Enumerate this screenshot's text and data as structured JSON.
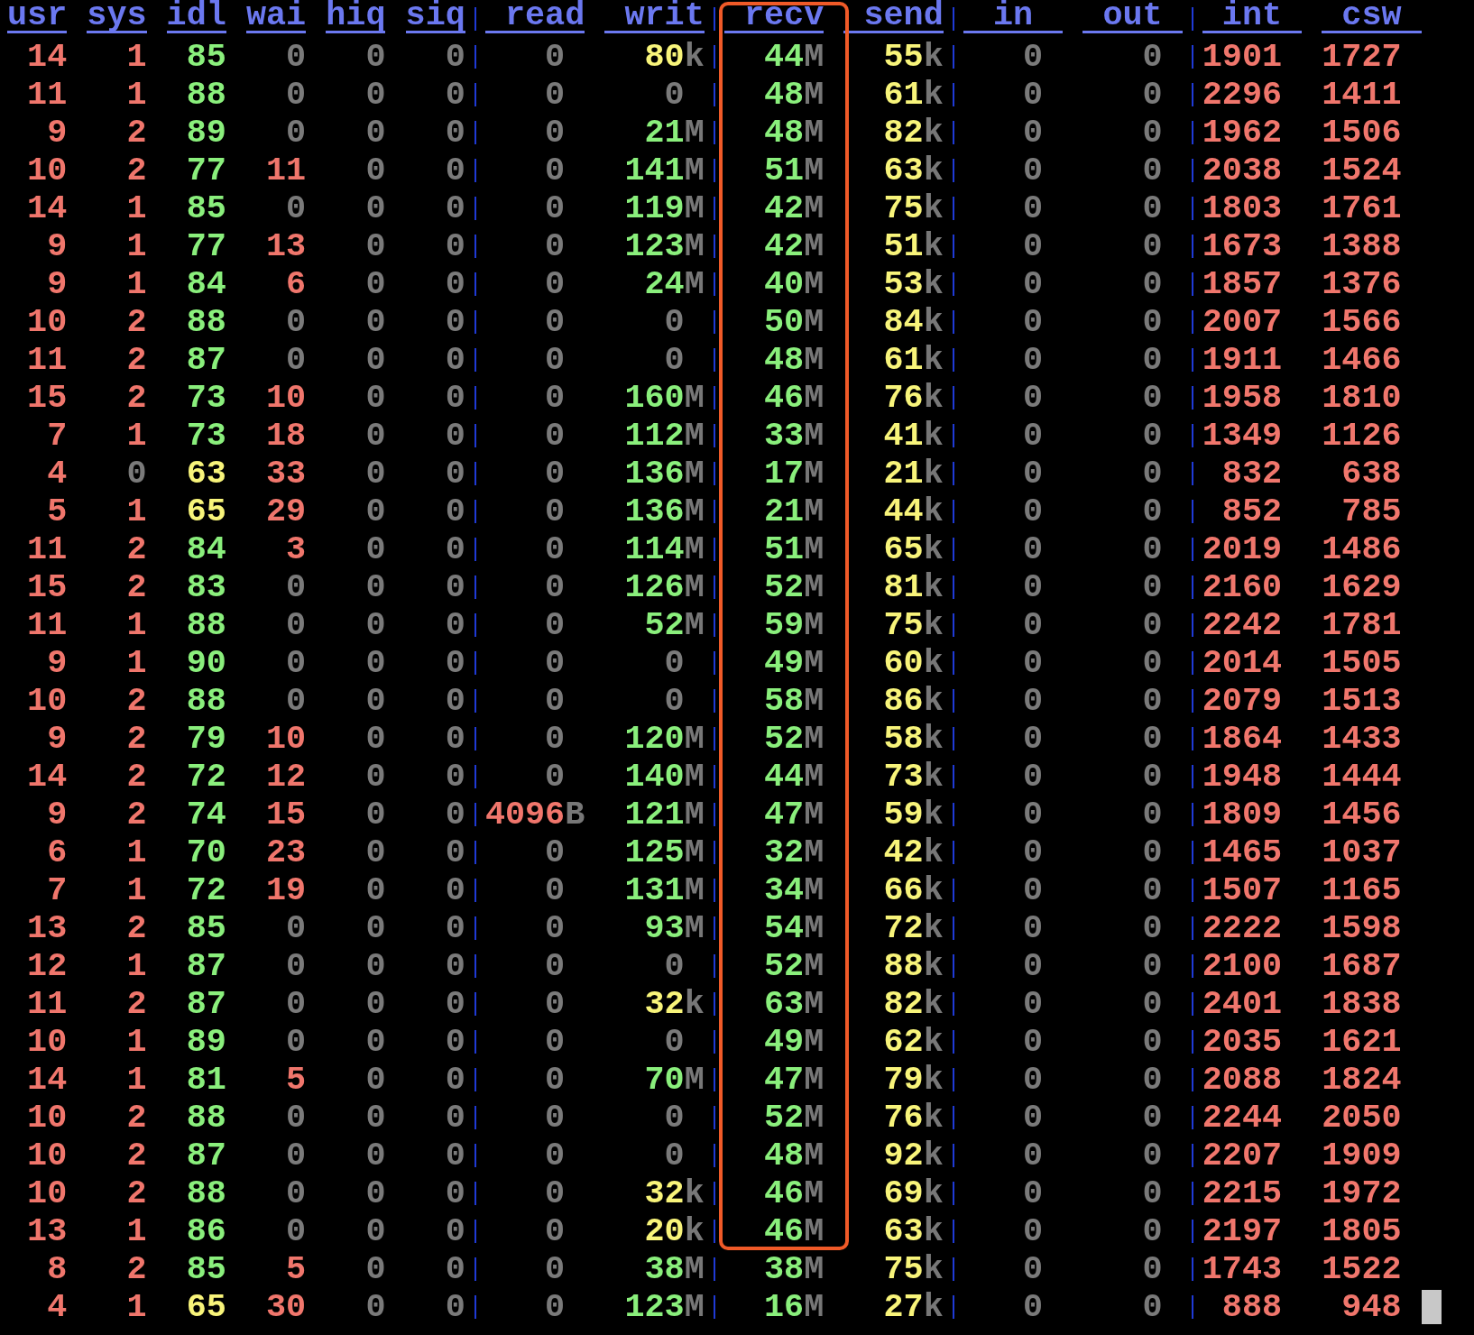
{
  "columns": [
    {
      "label": "usr",
      "kind": "cpu"
    },
    {
      "label": "sys",
      "kind": "cpu"
    },
    {
      "label": "idl",
      "kind": "cpu"
    },
    {
      "label": "wai",
      "kind": "cpu"
    },
    {
      "label": "hiq",
      "kind": "cpu"
    },
    {
      "label": "siq",
      "kind": "cpu"
    },
    {
      "label": "read",
      "kind": "throughput"
    },
    {
      "label": "writ",
      "kind": "throughput"
    },
    {
      "label": "recv",
      "kind": "throughput"
    },
    {
      "label": "send",
      "kind": "throughput"
    },
    {
      "label": "in",
      "kind": "counter"
    },
    {
      "label": "out",
      "kind": "counter"
    },
    {
      "label": "int",
      "kind": "counter"
    },
    {
      "label": "csw",
      "kind": "counter"
    }
  ],
  "rows": [
    {
      "cells": [
        {
          "value": "14",
          "color": "#f0766c"
        },
        {
          "value": "1",
          "color": "#f0766c"
        },
        {
          "value": "85",
          "color": "#8aef7c"
        },
        {
          "value": "0",
          "color": "#7a7a7a"
        },
        {
          "value": "0",
          "color": "#7a7a7a"
        },
        {
          "value": "0",
          "color": "#7a7a7a"
        },
        {
          "value": "0",
          "color": "#7a7a7a"
        },
        {
          "value": "80",
          "unit": "k",
          "color": "#f8f47a"
        },
        {
          "value": "44",
          "unit": "M",
          "color": "#8aef7c"
        },
        {
          "value": "55",
          "unit": "k",
          "color": "#f8f47a"
        },
        {
          "value": "0",
          "color": "#7a7a7a"
        },
        {
          "value": "0",
          "color": "#7a7a7a"
        },
        {
          "value": "1901",
          "color": "#f0766c"
        },
        {
          "value": "1727",
          "color": "#f0766c"
        }
      ]
    },
    {
      "cells": [
        {
          "value": "11",
          "color": "#f0766c"
        },
        {
          "value": "1",
          "color": "#f0766c"
        },
        {
          "value": "88",
          "color": "#8aef7c"
        },
        {
          "value": "0",
          "color": "#7a7a7a"
        },
        {
          "value": "0",
          "color": "#7a7a7a"
        },
        {
          "value": "0",
          "color": "#7a7a7a"
        },
        {
          "value": "0",
          "color": "#7a7a7a"
        },
        {
          "value": "0",
          "color": "#7a7a7a"
        },
        {
          "value": "48",
          "unit": "M",
          "color": "#8aef7c"
        },
        {
          "value": "61",
          "unit": "k",
          "color": "#f8f47a"
        },
        {
          "value": "0",
          "color": "#7a7a7a"
        },
        {
          "value": "0",
          "color": "#7a7a7a"
        },
        {
          "value": "2296",
          "color": "#f0766c"
        },
        {
          "value": "1411",
          "color": "#f0766c"
        }
      ]
    },
    {
      "cells": [
        {
          "value": "9",
          "color": "#f0766c"
        },
        {
          "value": "2",
          "color": "#f0766c"
        },
        {
          "value": "89",
          "color": "#8aef7c"
        },
        {
          "value": "0",
          "color": "#7a7a7a"
        },
        {
          "value": "0",
          "color": "#7a7a7a"
        },
        {
          "value": "0",
          "color": "#7a7a7a"
        },
        {
          "value": "0",
          "color": "#7a7a7a"
        },
        {
          "value": "21",
          "unit": "M",
          "color": "#8aef7c"
        },
        {
          "value": "48",
          "unit": "M",
          "color": "#8aef7c"
        },
        {
          "value": "82",
          "unit": "k",
          "color": "#f8f47a"
        },
        {
          "value": "0",
          "color": "#7a7a7a"
        },
        {
          "value": "0",
          "color": "#7a7a7a"
        },
        {
          "value": "1962",
          "color": "#f0766c"
        },
        {
          "value": "1506",
          "color": "#f0766c"
        }
      ]
    },
    {
      "cells": [
        {
          "value": "10",
          "color": "#f0766c"
        },
        {
          "value": "2",
          "color": "#f0766c"
        },
        {
          "value": "77",
          "color": "#8aef7c"
        },
        {
          "value": "11",
          "color": "#f0766c"
        },
        {
          "value": "0",
          "color": "#7a7a7a"
        },
        {
          "value": "0",
          "color": "#7a7a7a"
        },
        {
          "value": "0",
          "color": "#7a7a7a"
        },
        {
          "value": "141",
          "unit": "M",
          "color": "#8aef7c"
        },
        {
          "value": "51",
          "unit": "M",
          "color": "#8aef7c"
        },
        {
          "value": "63",
          "unit": "k",
          "color": "#f8f47a"
        },
        {
          "value": "0",
          "color": "#7a7a7a"
        },
        {
          "value": "0",
          "color": "#7a7a7a"
        },
        {
          "value": "2038",
          "color": "#f0766c"
        },
        {
          "value": "1524",
          "color": "#f0766c"
        }
      ]
    },
    {
      "cells": [
        {
          "value": "14",
          "color": "#f0766c"
        },
        {
          "value": "1",
          "color": "#f0766c"
        },
        {
          "value": "85",
          "color": "#8aef7c"
        },
        {
          "value": "0",
          "color": "#7a7a7a"
        },
        {
          "value": "0",
          "color": "#7a7a7a"
        },
        {
          "value": "0",
          "color": "#7a7a7a"
        },
        {
          "value": "0",
          "color": "#7a7a7a"
        },
        {
          "value": "119",
          "unit": "M",
          "color": "#8aef7c"
        },
        {
          "value": "42",
          "unit": "M",
          "color": "#8aef7c"
        },
        {
          "value": "75",
          "unit": "k",
          "color": "#f8f47a"
        },
        {
          "value": "0",
          "color": "#7a7a7a"
        },
        {
          "value": "0",
          "color": "#7a7a7a"
        },
        {
          "value": "1803",
          "color": "#f0766c"
        },
        {
          "value": "1761",
          "color": "#f0766c"
        }
      ]
    },
    {
      "cells": [
        {
          "value": "9",
          "color": "#f0766c"
        },
        {
          "value": "1",
          "color": "#f0766c"
        },
        {
          "value": "77",
          "color": "#8aef7c"
        },
        {
          "value": "13",
          "color": "#f0766c"
        },
        {
          "value": "0",
          "color": "#7a7a7a"
        },
        {
          "value": "0",
          "color": "#7a7a7a"
        },
        {
          "value": "0",
          "color": "#7a7a7a"
        },
        {
          "value": "123",
          "unit": "M",
          "color": "#8aef7c"
        },
        {
          "value": "42",
          "unit": "M",
          "color": "#8aef7c"
        },
        {
          "value": "51",
          "unit": "k",
          "color": "#f8f47a"
        },
        {
          "value": "0",
          "color": "#7a7a7a"
        },
        {
          "value": "0",
          "color": "#7a7a7a"
        },
        {
          "value": "1673",
          "color": "#f0766c"
        },
        {
          "value": "1388",
          "color": "#f0766c"
        }
      ]
    },
    {
      "cells": [
        {
          "value": "9",
          "color": "#f0766c"
        },
        {
          "value": "1",
          "color": "#f0766c"
        },
        {
          "value": "84",
          "color": "#8aef7c"
        },
        {
          "value": "6",
          "color": "#f0766c"
        },
        {
          "value": "0",
          "color": "#7a7a7a"
        },
        {
          "value": "0",
          "color": "#7a7a7a"
        },
        {
          "value": "0",
          "color": "#7a7a7a"
        },
        {
          "value": "24",
          "unit": "M",
          "color": "#8aef7c"
        },
        {
          "value": "40",
          "unit": "M",
          "color": "#8aef7c"
        },
        {
          "value": "53",
          "unit": "k",
          "color": "#f8f47a"
        },
        {
          "value": "0",
          "color": "#7a7a7a"
        },
        {
          "value": "0",
          "color": "#7a7a7a"
        },
        {
          "value": "1857",
          "color": "#f0766c"
        },
        {
          "value": "1376",
          "color": "#f0766c"
        }
      ]
    },
    {
      "cells": [
        {
          "value": "10",
          "color": "#f0766c"
        },
        {
          "value": "2",
          "color": "#f0766c"
        },
        {
          "value": "88",
          "color": "#8aef7c"
        },
        {
          "value": "0",
          "color": "#7a7a7a"
        },
        {
          "value": "0",
          "color": "#7a7a7a"
        },
        {
          "value": "0",
          "color": "#7a7a7a"
        },
        {
          "value": "0",
          "color": "#7a7a7a"
        },
        {
          "value": "0",
          "color": "#7a7a7a"
        },
        {
          "value": "50",
          "unit": "M",
          "color": "#8aef7c"
        },
        {
          "value": "84",
          "unit": "k",
          "color": "#f8f47a"
        },
        {
          "value": "0",
          "color": "#7a7a7a"
        },
        {
          "value": "0",
          "color": "#7a7a7a"
        },
        {
          "value": "2007",
          "color": "#f0766c"
        },
        {
          "value": "1566",
          "color": "#f0766c"
        }
      ]
    },
    {
      "cells": [
        {
          "value": "11",
          "color": "#f0766c"
        },
        {
          "value": "2",
          "color": "#f0766c"
        },
        {
          "value": "87",
          "color": "#8aef7c"
        },
        {
          "value": "0",
          "color": "#7a7a7a"
        },
        {
          "value": "0",
          "color": "#7a7a7a"
        },
        {
          "value": "0",
          "color": "#7a7a7a"
        },
        {
          "value": "0",
          "color": "#7a7a7a"
        },
        {
          "value": "0",
          "color": "#7a7a7a"
        },
        {
          "value": "48",
          "unit": "M",
          "color": "#8aef7c"
        },
        {
          "value": "61",
          "unit": "k",
          "color": "#f8f47a"
        },
        {
          "value": "0",
          "color": "#7a7a7a"
        },
        {
          "value": "0",
          "color": "#7a7a7a"
        },
        {
          "value": "1911",
          "color": "#f0766c"
        },
        {
          "value": "1466",
          "color": "#f0766c"
        }
      ]
    },
    {
      "cells": [
        {
          "value": "15",
          "color": "#f0766c"
        },
        {
          "value": "2",
          "color": "#f0766c"
        },
        {
          "value": "73",
          "color": "#8aef7c"
        },
        {
          "value": "10",
          "color": "#f0766c"
        },
        {
          "value": "0",
          "color": "#7a7a7a"
        },
        {
          "value": "0",
          "color": "#7a7a7a"
        },
        {
          "value": "0",
          "color": "#7a7a7a"
        },
        {
          "value": "160",
          "unit": "M",
          "color": "#8aef7c"
        },
        {
          "value": "46",
          "unit": "M",
          "color": "#8aef7c"
        },
        {
          "value": "76",
          "unit": "k",
          "color": "#f8f47a"
        },
        {
          "value": "0",
          "color": "#7a7a7a"
        },
        {
          "value": "0",
          "color": "#7a7a7a"
        },
        {
          "value": "1958",
          "color": "#f0766c"
        },
        {
          "value": "1810",
          "color": "#f0766c"
        }
      ]
    },
    {
      "cells": [
        {
          "value": "7",
          "color": "#f0766c"
        },
        {
          "value": "1",
          "color": "#f0766c"
        },
        {
          "value": "73",
          "color": "#8aef7c"
        },
        {
          "value": "18",
          "color": "#f0766c"
        },
        {
          "value": "0",
          "color": "#7a7a7a"
        },
        {
          "value": "0",
          "color": "#7a7a7a"
        },
        {
          "value": "0",
          "color": "#7a7a7a"
        },
        {
          "value": "112",
          "unit": "M",
          "color": "#8aef7c"
        },
        {
          "value": "33",
          "unit": "M",
          "color": "#8aef7c"
        },
        {
          "value": "41",
          "unit": "k",
          "color": "#f8f47a"
        },
        {
          "value": "0",
          "color": "#7a7a7a"
        },
        {
          "value": "0",
          "color": "#7a7a7a"
        },
        {
          "value": "1349",
          "color": "#f0766c"
        },
        {
          "value": "1126",
          "color": "#f0766c"
        }
      ]
    },
    {
      "cells": [
        {
          "value": "4",
          "color": "#f0766c"
        },
        {
          "value": "0",
          "color": "#7a7a7a"
        },
        {
          "value": "63",
          "color": "#f8f47a"
        },
        {
          "value": "33",
          "color": "#f0766c"
        },
        {
          "value": "0",
          "color": "#7a7a7a"
        },
        {
          "value": "0",
          "color": "#7a7a7a"
        },
        {
          "value": "0",
          "color": "#7a7a7a"
        },
        {
          "value": "136",
          "unit": "M",
          "color": "#8aef7c"
        },
        {
          "value": "17",
          "unit": "M",
          "color": "#8aef7c"
        },
        {
          "value": "21",
          "unit": "k",
          "color": "#f8f47a"
        },
        {
          "value": "0",
          "color": "#7a7a7a"
        },
        {
          "value": "0",
          "color": "#7a7a7a"
        },
        {
          "value": "832",
          "color": "#f0766c"
        },
        {
          "value": "638",
          "color": "#f0766c"
        }
      ]
    },
    {
      "cells": [
        {
          "value": "5",
          "color": "#f0766c"
        },
        {
          "value": "1",
          "color": "#f0766c"
        },
        {
          "value": "65",
          "color": "#f8f47a"
        },
        {
          "value": "29",
          "color": "#f0766c"
        },
        {
          "value": "0",
          "color": "#7a7a7a"
        },
        {
          "value": "0",
          "color": "#7a7a7a"
        },
        {
          "value": "0",
          "color": "#7a7a7a"
        },
        {
          "value": "136",
          "unit": "M",
          "color": "#8aef7c"
        },
        {
          "value": "21",
          "unit": "M",
          "color": "#8aef7c"
        },
        {
          "value": "44",
          "unit": "k",
          "color": "#f8f47a"
        },
        {
          "value": "0",
          "color": "#7a7a7a"
        },
        {
          "value": "0",
          "color": "#7a7a7a"
        },
        {
          "value": "852",
          "color": "#f0766c"
        },
        {
          "value": "785",
          "color": "#f0766c"
        }
      ]
    },
    {
      "cells": [
        {
          "value": "11",
          "color": "#f0766c"
        },
        {
          "value": "2",
          "color": "#f0766c"
        },
        {
          "value": "84",
          "color": "#8aef7c"
        },
        {
          "value": "3",
          "color": "#f0766c"
        },
        {
          "value": "0",
          "color": "#7a7a7a"
        },
        {
          "value": "0",
          "color": "#7a7a7a"
        },
        {
          "value": "0",
          "color": "#7a7a7a"
        },
        {
          "value": "114",
          "unit": "M",
          "color": "#8aef7c"
        },
        {
          "value": "51",
          "unit": "M",
          "color": "#8aef7c"
        },
        {
          "value": "65",
          "unit": "k",
          "color": "#f8f47a"
        },
        {
          "value": "0",
          "color": "#7a7a7a"
        },
        {
          "value": "0",
          "color": "#7a7a7a"
        },
        {
          "value": "2019",
          "color": "#f0766c"
        },
        {
          "value": "1486",
          "color": "#f0766c"
        }
      ]
    },
    {
      "cells": [
        {
          "value": "15",
          "color": "#f0766c"
        },
        {
          "value": "2",
          "color": "#f0766c"
        },
        {
          "value": "83",
          "color": "#8aef7c"
        },
        {
          "value": "0",
          "color": "#7a7a7a"
        },
        {
          "value": "0",
          "color": "#7a7a7a"
        },
        {
          "value": "0",
          "color": "#7a7a7a"
        },
        {
          "value": "0",
          "color": "#7a7a7a"
        },
        {
          "value": "126",
          "unit": "M",
          "color": "#8aef7c"
        },
        {
          "value": "52",
          "unit": "M",
          "color": "#8aef7c"
        },
        {
          "value": "81",
          "unit": "k",
          "color": "#f8f47a"
        },
        {
          "value": "0",
          "color": "#7a7a7a"
        },
        {
          "value": "0",
          "color": "#7a7a7a"
        },
        {
          "value": "2160",
          "color": "#f0766c"
        },
        {
          "value": "1629",
          "color": "#f0766c"
        }
      ]
    },
    {
      "cells": [
        {
          "value": "11",
          "color": "#f0766c"
        },
        {
          "value": "1",
          "color": "#f0766c"
        },
        {
          "value": "88",
          "color": "#8aef7c"
        },
        {
          "value": "0",
          "color": "#7a7a7a"
        },
        {
          "value": "0",
          "color": "#7a7a7a"
        },
        {
          "value": "0",
          "color": "#7a7a7a"
        },
        {
          "value": "0",
          "color": "#7a7a7a"
        },
        {
          "value": "52",
          "unit": "M",
          "color": "#8aef7c"
        },
        {
          "value": "59",
          "unit": "M",
          "color": "#8aef7c"
        },
        {
          "value": "75",
          "unit": "k",
          "color": "#f8f47a"
        },
        {
          "value": "0",
          "color": "#7a7a7a"
        },
        {
          "value": "0",
          "color": "#7a7a7a"
        },
        {
          "value": "2242",
          "color": "#f0766c"
        },
        {
          "value": "1781",
          "color": "#f0766c"
        }
      ]
    },
    {
      "cells": [
        {
          "value": "9",
          "color": "#f0766c"
        },
        {
          "value": "1",
          "color": "#f0766c"
        },
        {
          "value": "90",
          "color": "#8aef7c"
        },
        {
          "value": "0",
          "color": "#7a7a7a"
        },
        {
          "value": "0",
          "color": "#7a7a7a"
        },
        {
          "value": "0",
          "color": "#7a7a7a"
        },
        {
          "value": "0",
          "color": "#7a7a7a"
        },
        {
          "value": "0",
          "color": "#7a7a7a"
        },
        {
          "value": "49",
          "unit": "M",
          "color": "#8aef7c"
        },
        {
          "value": "60",
          "unit": "k",
          "color": "#f8f47a"
        },
        {
          "value": "0",
          "color": "#7a7a7a"
        },
        {
          "value": "0",
          "color": "#7a7a7a"
        },
        {
          "value": "2014",
          "color": "#f0766c"
        },
        {
          "value": "1505",
          "color": "#f0766c"
        }
      ]
    },
    {
      "cells": [
        {
          "value": "10",
          "color": "#f0766c"
        },
        {
          "value": "2",
          "color": "#f0766c"
        },
        {
          "value": "88",
          "color": "#8aef7c"
        },
        {
          "value": "0",
          "color": "#7a7a7a"
        },
        {
          "value": "0",
          "color": "#7a7a7a"
        },
        {
          "value": "0",
          "color": "#7a7a7a"
        },
        {
          "value": "0",
          "color": "#7a7a7a"
        },
        {
          "value": "0",
          "color": "#7a7a7a"
        },
        {
          "value": "58",
          "unit": "M",
          "color": "#8aef7c"
        },
        {
          "value": "86",
          "unit": "k",
          "color": "#f8f47a"
        },
        {
          "value": "0",
          "color": "#7a7a7a"
        },
        {
          "value": "0",
          "color": "#7a7a7a"
        },
        {
          "value": "2079",
          "color": "#f0766c"
        },
        {
          "value": "1513",
          "color": "#f0766c"
        }
      ]
    },
    {
      "cells": [
        {
          "value": "9",
          "color": "#f0766c"
        },
        {
          "value": "2",
          "color": "#f0766c"
        },
        {
          "value": "79",
          "color": "#8aef7c"
        },
        {
          "value": "10",
          "color": "#f0766c"
        },
        {
          "value": "0",
          "color": "#7a7a7a"
        },
        {
          "value": "0",
          "color": "#7a7a7a"
        },
        {
          "value": "0",
          "color": "#7a7a7a"
        },
        {
          "value": "120",
          "unit": "M",
          "color": "#8aef7c"
        },
        {
          "value": "52",
          "unit": "M",
          "color": "#8aef7c"
        },
        {
          "value": "58",
          "unit": "k",
          "color": "#f8f47a"
        },
        {
          "value": "0",
          "color": "#7a7a7a"
        },
        {
          "value": "0",
          "color": "#7a7a7a"
        },
        {
          "value": "1864",
          "color": "#f0766c"
        },
        {
          "value": "1433",
          "color": "#f0766c"
        }
      ]
    },
    {
      "cells": [
        {
          "value": "14",
          "color": "#f0766c"
        },
        {
          "value": "2",
          "color": "#f0766c"
        },
        {
          "value": "72",
          "color": "#8aef7c"
        },
        {
          "value": "12",
          "color": "#f0766c"
        },
        {
          "value": "0",
          "color": "#7a7a7a"
        },
        {
          "value": "0",
          "color": "#7a7a7a"
        },
        {
          "value": "0",
          "color": "#7a7a7a"
        },
        {
          "value": "140",
          "unit": "M",
          "color": "#8aef7c"
        },
        {
          "value": "44",
          "unit": "M",
          "color": "#8aef7c"
        },
        {
          "value": "73",
          "unit": "k",
          "color": "#f8f47a"
        },
        {
          "value": "0",
          "color": "#7a7a7a"
        },
        {
          "value": "0",
          "color": "#7a7a7a"
        },
        {
          "value": "1948",
          "color": "#f0766c"
        },
        {
          "value": "1444",
          "color": "#f0766c"
        }
      ]
    },
    {
      "cells": [
        {
          "value": "9",
          "color": "#f0766c"
        },
        {
          "value": "2",
          "color": "#f0766c"
        },
        {
          "value": "74",
          "color": "#8aef7c"
        },
        {
          "value": "15",
          "color": "#f0766c"
        },
        {
          "value": "0",
          "color": "#7a7a7a"
        },
        {
          "value": "0",
          "color": "#7a7a7a"
        },
        {
          "value": "4096",
          "unit": "B",
          "color": "#f0766c"
        },
        {
          "value": "121",
          "unit": "M",
          "color": "#8aef7c"
        },
        {
          "value": "47",
          "unit": "M",
          "color": "#8aef7c"
        },
        {
          "value": "59",
          "unit": "k",
          "color": "#f8f47a"
        },
        {
          "value": "0",
          "color": "#7a7a7a"
        },
        {
          "value": "0",
          "color": "#7a7a7a"
        },
        {
          "value": "1809",
          "color": "#f0766c"
        },
        {
          "value": "1456",
          "color": "#f0766c"
        }
      ]
    },
    {
      "cells": [
        {
          "value": "6",
          "color": "#f0766c"
        },
        {
          "value": "1",
          "color": "#f0766c"
        },
        {
          "value": "70",
          "color": "#8aef7c"
        },
        {
          "value": "23",
          "color": "#f0766c"
        },
        {
          "value": "0",
          "color": "#7a7a7a"
        },
        {
          "value": "0",
          "color": "#7a7a7a"
        },
        {
          "value": "0",
          "color": "#7a7a7a"
        },
        {
          "value": "125",
          "unit": "M",
          "color": "#8aef7c"
        },
        {
          "value": "32",
          "unit": "M",
          "color": "#8aef7c"
        },
        {
          "value": "42",
          "unit": "k",
          "color": "#f8f47a"
        },
        {
          "value": "0",
          "color": "#7a7a7a"
        },
        {
          "value": "0",
          "color": "#7a7a7a"
        },
        {
          "value": "1465",
          "color": "#f0766c"
        },
        {
          "value": "1037",
          "color": "#f0766c"
        }
      ]
    },
    {
      "cells": [
        {
          "value": "7",
          "color": "#f0766c"
        },
        {
          "value": "1",
          "color": "#f0766c"
        },
        {
          "value": "72",
          "color": "#8aef7c"
        },
        {
          "value": "19",
          "color": "#f0766c"
        },
        {
          "value": "0",
          "color": "#7a7a7a"
        },
        {
          "value": "0",
          "color": "#7a7a7a"
        },
        {
          "value": "0",
          "color": "#7a7a7a"
        },
        {
          "value": "131",
          "unit": "M",
          "color": "#8aef7c"
        },
        {
          "value": "34",
          "unit": "M",
          "color": "#8aef7c"
        },
        {
          "value": "66",
          "unit": "k",
          "color": "#f8f47a"
        },
        {
          "value": "0",
          "color": "#7a7a7a"
        },
        {
          "value": "0",
          "color": "#7a7a7a"
        },
        {
          "value": "1507",
          "color": "#f0766c"
        },
        {
          "value": "1165",
          "color": "#f0766c"
        }
      ]
    },
    {
      "cells": [
        {
          "value": "13",
          "color": "#f0766c"
        },
        {
          "value": "2",
          "color": "#f0766c"
        },
        {
          "value": "85",
          "color": "#8aef7c"
        },
        {
          "value": "0",
          "color": "#7a7a7a"
        },
        {
          "value": "0",
          "color": "#7a7a7a"
        },
        {
          "value": "0",
          "color": "#7a7a7a"
        },
        {
          "value": "0",
          "color": "#7a7a7a"
        },
        {
          "value": "93",
          "unit": "M",
          "color": "#8aef7c"
        },
        {
          "value": "54",
          "unit": "M",
          "color": "#8aef7c"
        },
        {
          "value": "72",
          "unit": "k",
          "color": "#f8f47a"
        },
        {
          "value": "0",
          "color": "#7a7a7a"
        },
        {
          "value": "0",
          "color": "#7a7a7a"
        },
        {
          "value": "2222",
          "color": "#f0766c"
        },
        {
          "value": "1598",
          "color": "#f0766c"
        }
      ]
    },
    {
      "cells": [
        {
          "value": "12",
          "color": "#f0766c"
        },
        {
          "value": "1",
          "color": "#f0766c"
        },
        {
          "value": "87",
          "color": "#8aef7c"
        },
        {
          "value": "0",
          "color": "#7a7a7a"
        },
        {
          "value": "0",
          "color": "#7a7a7a"
        },
        {
          "value": "0",
          "color": "#7a7a7a"
        },
        {
          "value": "0",
          "color": "#7a7a7a"
        },
        {
          "value": "0",
          "color": "#7a7a7a"
        },
        {
          "value": "52",
          "unit": "M",
          "color": "#8aef7c"
        },
        {
          "value": "88",
          "unit": "k",
          "color": "#f8f47a"
        },
        {
          "value": "0",
          "color": "#7a7a7a"
        },
        {
          "value": "0",
          "color": "#7a7a7a"
        },
        {
          "value": "2100",
          "color": "#f0766c"
        },
        {
          "value": "1687",
          "color": "#f0766c"
        }
      ]
    },
    {
      "cells": [
        {
          "value": "11",
          "color": "#f0766c"
        },
        {
          "value": "2",
          "color": "#f0766c"
        },
        {
          "value": "87",
          "color": "#8aef7c"
        },
        {
          "value": "0",
          "color": "#7a7a7a"
        },
        {
          "value": "0",
          "color": "#7a7a7a"
        },
        {
          "value": "0",
          "color": "#7a7a7a"
        },
        {
          "value": "0",
          "color": "#7a7a7a"
        },
        {
          "value": "32",
          "unit": "k",
          "color": "#f8f47a"
        },
        {
          "value": "63",
          "unit": "M",
          "color": "#8aef7c"
        },
        {
          "value": "82",
          "unit": "k",
          "color": "#f8f47a"
        },
        {
          "value": "0",
          "color": "#7a7a7a"
        },
        {
          "value": "0",
          "color": "#7a7a7a"
        },
        {
          "value": "2401",
          "color": "#f0766c"
        },
        {
          "value": "1838",
          "color": "#f0766c"
        }
      ]
    },
    {
      "cells": [
        {
          "value": "10",
          "color": "#f0766c"
        },
        {
          "value": "1",
          "color": "#f0766c"
        },
        {
          "value": "89",
          "color": "#8aef7c"
        },
        {
          "value": "0",
          "color": "#7a7a7a"
        },
        {
          "value": "0",
          "color": "#7a7a7a"
        },
        {
          "value": "0",
          "color": "#7a7a7a"
        },
        {
          "value": "0",
          "color": "#7a7a7a"
        },
        {
          "value": "0",
          "color": "#7a7a7a"
        },
        {
          "value": "49",
          "unit": "M",
          "color": "#8aef7c"
        },
        {
          "value": "62",
          "unit": "k",
          "color": "#f8f47a"
        },
        {
          "value": "0",
          "color": "#7a7a7a"
        },
        {
          "value": "0",
          "color": "#7a7a7a"
        },
        {
          "value": "2035",
          "color": "#f0766c"
        },
        {
          "value": "1621",
          "color": "#f0766c"
        }
      ]
    },
    {
      "cells": [
        {
          "value": "14",
          "color": "#f0766c"
        },
        {
          "value": "1",
          "color": "#f0766c"
        },
        {
          "value": "81",
          "color": "#8aef7c"
        },
        {
          "value": "5",
          "color": "#f0766c"
        },
        {
          "value": "0",
          "color": "#7a7a7a"
        },
        {
          "value": "0",
          "color": "#7a7a7a"
        },
        {
          "value": "0",
          "color": "#7a7a7a"
        },
        {
          "value": "70",
          "unit": "M",
          "color": "#8aef7c"
        },
        {
          "value": "47",
          "unit": "M",
          "color": "#8aef7c"
        },
        {
          "value": "79",
          "unit": "k",
          "color": "#f8f47a"
        },
        {
          "value": "0",
          "color": "#7a7a7a"
        },
        {
          "value": "0",
          "color": "#7a7a7a"
        },
        {
          "value": "2088",
          "color": "#f0766c"
        },
        {
          "value": "1824",
          "color": "#f0766c"
        }
      ]
    },
    {
      "cells": [
        {
          "value": "10",
          "color": "#f0766c"
        },
        {
          "value": "2",
          "color": "#f0766c"
        },
        {
          "value": "88",
          "color": "#8aef7c"
        },
        {
          "value": "0",
          "color": "#7a7a7a"
        },
        {
          "value": "0",
          "color": "#7a7a7a"
        },
        {
          "value": "0",
          "color": "#7a7a7a"
        },
        {
          "value": "0",
          "color": "#7a7a7a"
        },
        {
          "value": "0",
          "color": "#7a7a7a"
        },
        {
          "value": "52",
          "unit": "M",
          "color": "#8aef7c"
        },
        {
          "value": "76",
          "unit": "k",
          "color": "#f8f47a"
        },
        {
          "value": "0",
          "color": "#7a7a7a"
        },
        {
          "value": "0",
          "color": "#7a7a7a"
        },
        {
          "value": "2244",
          "color": "#f0766c"
        },
        {
          "value": "2050",
          "color": "#f0766c"
        }
      ]
    },
    {
      "cells": [
        {
          "value": "10",
          "color": "#f0766c"
        },
        {
          "value": "2",
          "color": "#f0766c"
        },
        {
          "value": "87",
          "color": "#8aef7c"
        },
        {
          "value": "0",
          "color": "#7a7a7a"
        },
        {
          "value": "0",
          "color": "#7a7a7a"
        },
        {
          "value": "0",
          "color": "#7a7a7a"
        },
        {
          "value": "0",
          "color": "#7a7a7a"
        },
        {
          "value": "0",
          "color": "#7a7a7a"
        },
        {
          "value": "48",
          "unit": "M",
          "color": "#8aef7c"
        },
        {
          "value": "92",
          "unit": "k",
          "color": "#f8f47a"
        },
        {
          "value": "0",
          "color": "#7a7a7a"
        },
        {
          "value": "0",
          "color": "#7a7a7a"
        },
        {
          "value": "2207",
          "color": "#f0766c"
        },
        {
          "value": "1909",
          "color": "#f0766c"
        }
      ]
    },
    {
      "cells": [
        {
          "value": "10",
          "color": "#f0766c"
        },
        {
          "value": "2",
          "color": "#f0766c"
        },
        {
          "value": "88",
          "color": "#8aef7c"
        },
        {
          "value": "0",
          "color": "#7a7a7a"
        },
        {
          "value": "0",
          "color": "#7a7a7a"
        },
        {
          "value": "0",
          "color": "#7a7a7a"
        },
        {
          "value": "0",
          "color": "#7a7a7a"
        },
        {
          "value": "32",
          "unit": "k",
          "color": "#f8f47a"
        },
        {
          "value": "46",
          "unit": "M",
          "color": "#8aef7c"
        },
        {
          "value": "69",
          "unit": "k",
          "color": "#f8f47a"
        },
        {
          "value": "0",
          "color": "#7a7a7a"
        },
        {
          "value": "0",
          "color": "#7a7a7a"
        },
        {
          "value": "2215",
          "color": "#f0766c"
        },
        {
          "value": "1972",
          "color": "#f0766c"
        }
      ]
    },
    {
      "cells": [
        {
          "value": "13",
          "color": "#f0766c"
        },
        {
          "value": "1",
          "color": "#f0766c"
        },
        {
          "value": "86",
          "color": "#8aef7c"
        },
        {
          "value": "0",
          "color": "#7a7a7a"
        },
        {
          "value": "0",
          "color": "#7a7a7a"
        },
        {
          "value": "0",
          "color": "#7a7a7a"
        },
        {
          "value": "0",
          "color": "#7a7a7a"
        },
        {
          "value": "20",
          "unit": "k",
          "color": "#f8f47a"
        },
        {
          "value": "46",
          "unit": "M",
          "color": "#8aef7c"
        },
        {
          "value": "63",
          "unit": "k",
          "color": "#f8f47a"
        },
        {
          "value": "0",
          "color": "#7a7a7a"
        },
        {
          "value": "0",
          "color": "#7a7a7a"
        },
        {
          "value": "2197",
          "color": "#f0766c"
        },
        {
          "value": "1805",
          "color": "#f0766c"
        }
      ]
    },
    {
      "cells": [
        {
          "value": "8",
          "color": "#f0766c"
        },
        {
          "value": "2",
          "color": "#f0766c"
        },
        {
          "value": "85",
          "color": "#8aef7c"
        },
        {
          "value": "5",
          "color": "#f0766c"
        },
        {
          "value": "0",
          "color": "#7a7a7a"
        },
        {
          "value": "0",
          "color": "#7a7a7a"
        },
        {
          "value": "0",
          "color": "#7a7a7a"
        },
        {
          "value": "38",
          "unit": "M",
          "color": "#8aef7c"
        },
        {
          "value": "38",
          "unit": "M",
          "color": "#8aef7c"
        },
        {
          "value": "75",
          "unit": "k",
          "color": "#f8f47a"
        },
        {
          "value": "0",
          "color": "#7a7a7a"
        },
        {
          "value": "0",
          "color": "#7a7a7a"
        },
        {
          "value": "1743",
          "color": "#f0766c"
        },
        {
          "value": "1522",
          "color": "#f0766c"
        }
      ]
    },
    {
      "cells": [
        {
          "value": "4",
          "color": "#f0766c"
        },
        {
          "value": "1",
          "color": "#f0766c"
        },
        {
          "value": "65",
          "color": "#f8f47a"
        },
        {
          "value": "30",
          "color": "#f0766c"
        },
        {
          "value": "0",
          "color": "#7a7a7a"
        },
        {
          "value": "0",
          "color": "#7a7a7a"
        },
        {
          "value": "0",
          "color": "#7a7a7a"
        },
        {
          "value": "123",
          "unit": "M",
          "color": "#8aef7c"
        },
        {
          "value": "16",
          "unit": "M",
          "color": "#8aef7c"
        },
        {
          "value": "27",
          "unit": "k",
          "color": "#f8f47a"
        },
        {
          "value": "0",
          "color": "#7a7a7a"
        },
        {
          "value": "0",
          "color": "#7a7a7a"
        },
        {
          "value": "888",
          "color": "#f0766c"
        },
        {
          "value": "948",
          "color": "#f0766c"
        }
      ]
    }
  ],
  "annotation": {
    "kind": "outline"
  },
  "cursor_visible": true
}
